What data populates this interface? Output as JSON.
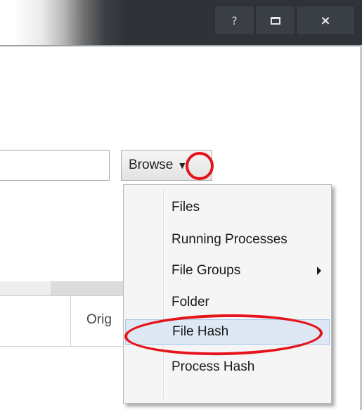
{
  "titlebar": {
    "help_label": "?",
    "close_label": "×"
  },
  "form": {
    "path_value": "",
    "browse_label": "Browse"
  },
  "grid": {
    "column_header_partial": "Orig"
  },
  "browse_menu": {
    "items": [
      {
        "label": "Files",
        "has_submenu": false,
        "highlighted": false
      },
      {
        "label": "Running Processes",
        "has_submenu": false,
        "highlighted": false
      },
      {
        "label": "File Groups",
        "has_submenu": true,
        "highlighted": false
      },
      {
        "label": "Folder",
        "has_submenu": false,
        "highlighted": false
      },
      {
        "label": "File Hash",
        "has_submenu": false,
        "highlighted": true
      },
      {
        "label": "Process Hash",
        "has_submenu": false,
        "highlighted": false
      }
    ]
  },
  "colors": {
    "titlebar_dark": "#2f3338",
    "menu_background": "#f5f5f5",
    "highlight_fill": "#dde8f4",
    "highlight_border": "#a8c8ea",
    "annotation_red": "#e5141b"
  },
  "icons": {
    "help": "help-icon",
    "maximize": "maximize-icon",
    "close": "close-icon",
    "dropdown": "chevron-down-icon",
    "submenu": "chevron-right-icon"
  }
}
